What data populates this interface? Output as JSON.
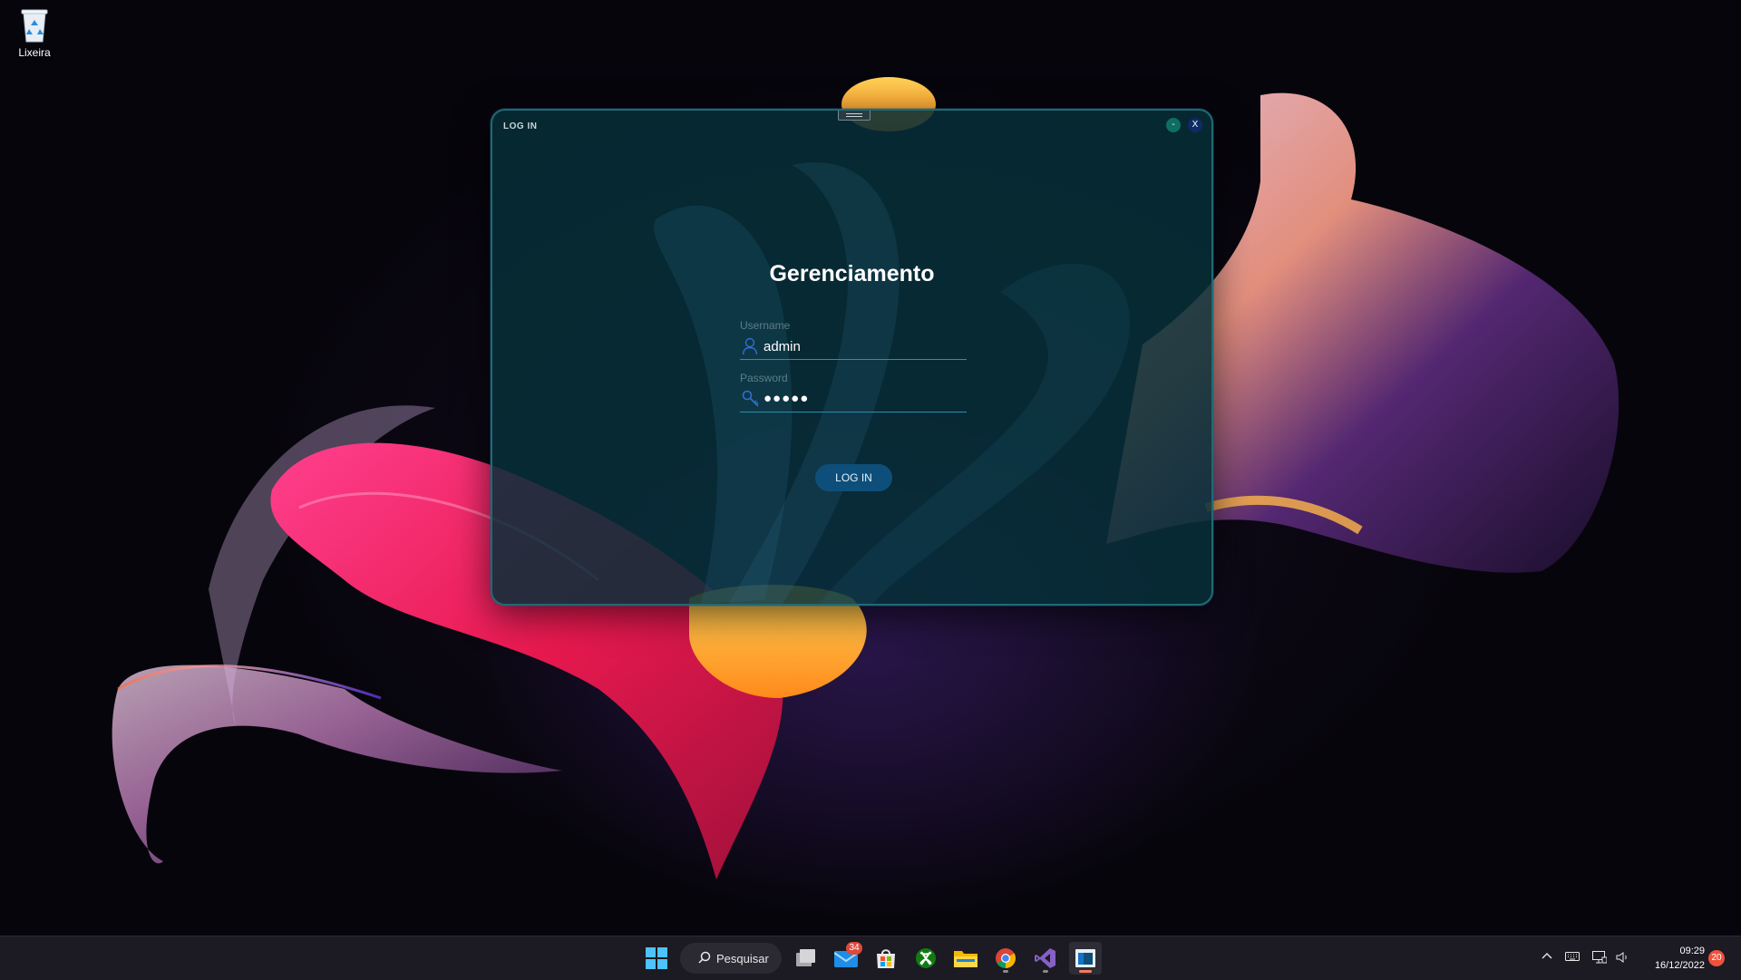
{
  "desktop": {
    "icons": [
      {
        "label": "Lixeira",
        "icon": "recycle-bin-icon"
      }
    ]
  },
  "login_window": {
    "title": "LOG IN",
    "minimize_label": "-",
    "close_label": "X",
    "heading": "Gerenciamento",
    "username": {
      "label": "Username",
      "value": "admin",
      "icon": "user-icon"
    },
    "password": {
      "label": "Password",
      "value": "●●●●●",
      "icon": "key-icon"
    },
    "login_button_label": "LOG IN",
    "colors": {
      "window_bg": "#062e38",
      "border": "#1e6b73",
      "accent": "#2a90ab",
      "button": "#0d4f7a"
    }
  },
  "taskbar": {
    "search": {
      "label": "Pesquisar",
      "icon": "search-icon"
    },
    "apps": [
      {
        "name": "start-button",
        "icon": "windows-logo-icon"
      },
      {
        "name": "task-view",
        "icon": "task-view-icon"
      },
      {
        "name": "mail",
        "icon": "mail-icon",
        "badge": "34"
      },
      {
        "name": "microsoft-store",
        "icon": "store-icon"
      },
      {
        "name": "xbox",
        "icon": "xbox-icon"
      },
      {
        "name": "file-explorer",
        "icon": "folder-icon"
      },
      {
        "name": "chrome",
        "icon": "chrome-icon"
      },
      {
        "name": "visual-studio",
        "icon": "visual-studio-icon"
      },
      {
        "name": "login-app",
        "icon": "app-window-icon",
        "active": true
      }
    ],
    "tray": {
      "icons": [
        "chevron-up-icon",
        "keyboard-icon",
        "network-icon",
        "volume-icon"
      ],
      "time": "09:29",
      "date": "16/12/2022",
      "notification_count": "20"
    }
  }
}
